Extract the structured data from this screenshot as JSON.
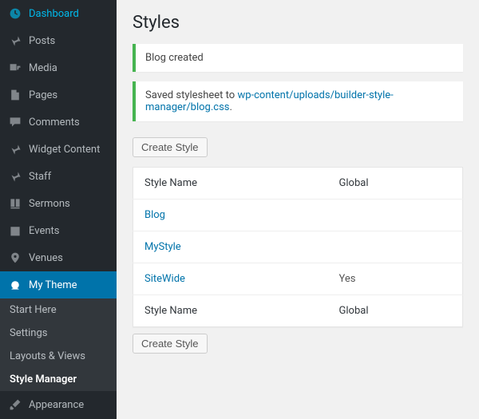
{
  "sidebar": {
    "items": [
      {
        "label": "Dashboard"
      },
      {
        "label": "Posts"
      },
      {
        "label": "Media"
      },
      {
        "label": "Pages"
      },
      {
        "label": "Comments"
      },
      {
        "label": "Widget Content"
      },
      {
        "label": "Staff"
      },
      {
        "label": "Sermons"
      },
      {
        "label": "Events"
      },
      {
        "label": "Venues"
      },
      {
        "label": "My Theme",
        "active": true
      },
      {
        "label": "Appearance"
      }
    ],
    "submenu": [
      {
        "label": "Start Here"
      },
      {
        "label": "Settings"
      },
      {
        "label": "Layouts & Views"
      },
      {
        "label": "Style Manager",
        "current": true
      }
    ]
  },
  "page": {
    "title": "Styles",
    "notice_created": "Blog created",
    "notice_saved_prefix": "Saved stylesheet to ",
    "notice_saved_link": "wp-content/uploads/builder-style-manager/blog.css",
    "notice_saved_suffix": ".",
    "create_button": "Create Style",
    "table": {
      "headers": {
        "name": "Style Name",
        "global": "Global"
      },
      "rows": [
        {
          "name": "Blog",
          "global": ""
        },
        {
          "name": "MyStyle",
          "global": ""
        },
        {
          "name": "SiteWide",
          "global": "Yes"
        }
      ]
    }
  }
}
